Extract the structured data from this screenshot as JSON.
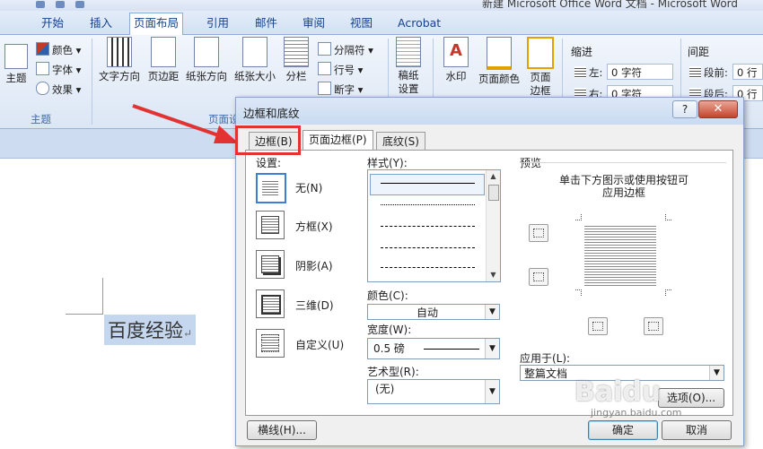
{
  "window": {
    "title": "新建 Microsoft Office Word 文档 - Microsoft Word"
  },
  "ribbon_tabs": [
    "开始",
    "插入",
    "页面布局",
    "引用",
    "邮件",
    "审阅",
    "视图",
    "Acrobat"
  ],
  "ribbon": {
    "theme_group": {
      "label": "主题",
      "theme_btn": "主题",
      "colors": "颜色",
      "fonts": "字体",
      "effects": "效果"
    },
    "page_setup_group": {
      "label": "页面设",
      "buttons": [
        "文字方向",
        "页边距",
        "纸张方向",
        "纸张大小",
        "分栏"
      ],
      "separators": "分隔符",
      "line_numbers": "行号",
      "hyphenation": "断字"
    },
    "draft_btn": "稿纸\n设置",
    "background_group": {
      "watermark": "水印",
      "page_color": "页面颜色",
      "page_border": "页面\n边框"
    },
    "indent_group": {
      "label": "缩进",
      "left_label": "左:",
      "left_value": "0 字符",
      "right_label": "右:",
      "right_value": "0 字符"
    },
    "spacing_group": {
      "label": "间距",
      "before_label": "段前:",
      "before_value": "0 行",
      "after_label": "段后:",
      "after_value": "0 行"
    }
  },
  "document": {
    "text": "百度经验",
    "para_mark": "↵"
  },
  "dialog": {
    "title": "边框和底纹",
    "help": "?",
    "close": "✕",
    "tabs": [
      "边框(B)",
      "页面边框(P)",
      "底纹(S)"
    ],
    "settings_label": "设置:",
    "settings": [
      "无(N)",
      "方框(X)",
      "阴影(A)",
      "三维(D)",
      "自定义(U)"
    ],
    "style_label": "样式(Y):",
    "color_label": "颜色(C):",
    "color_value": "自动",
    "width_label": "宽度(W):",
    "width_value": "0.5 磅",
    "art_label": "艺术型(R):",
    "art_value": "(无)",
    "preview_label": "预览",
    "preview_hint_1": "单击下方图示或使用按钮可",
    "preview_hint_2": "应用边框",
    "apply_label": "应用于(L):",
    "apply_value": "整篇文档",
    "options_button": "选项(O)...",
    "hline_button": "横线(H)...",
    "ok_button": "确定",
    "cancel_button": "取消"
  },
  "annotation": {
    "color": "#e23232"
  },
  "watermark": {
    "main": "Baidu",
    "sub": "jingyan.baidu.com"
  }
}
